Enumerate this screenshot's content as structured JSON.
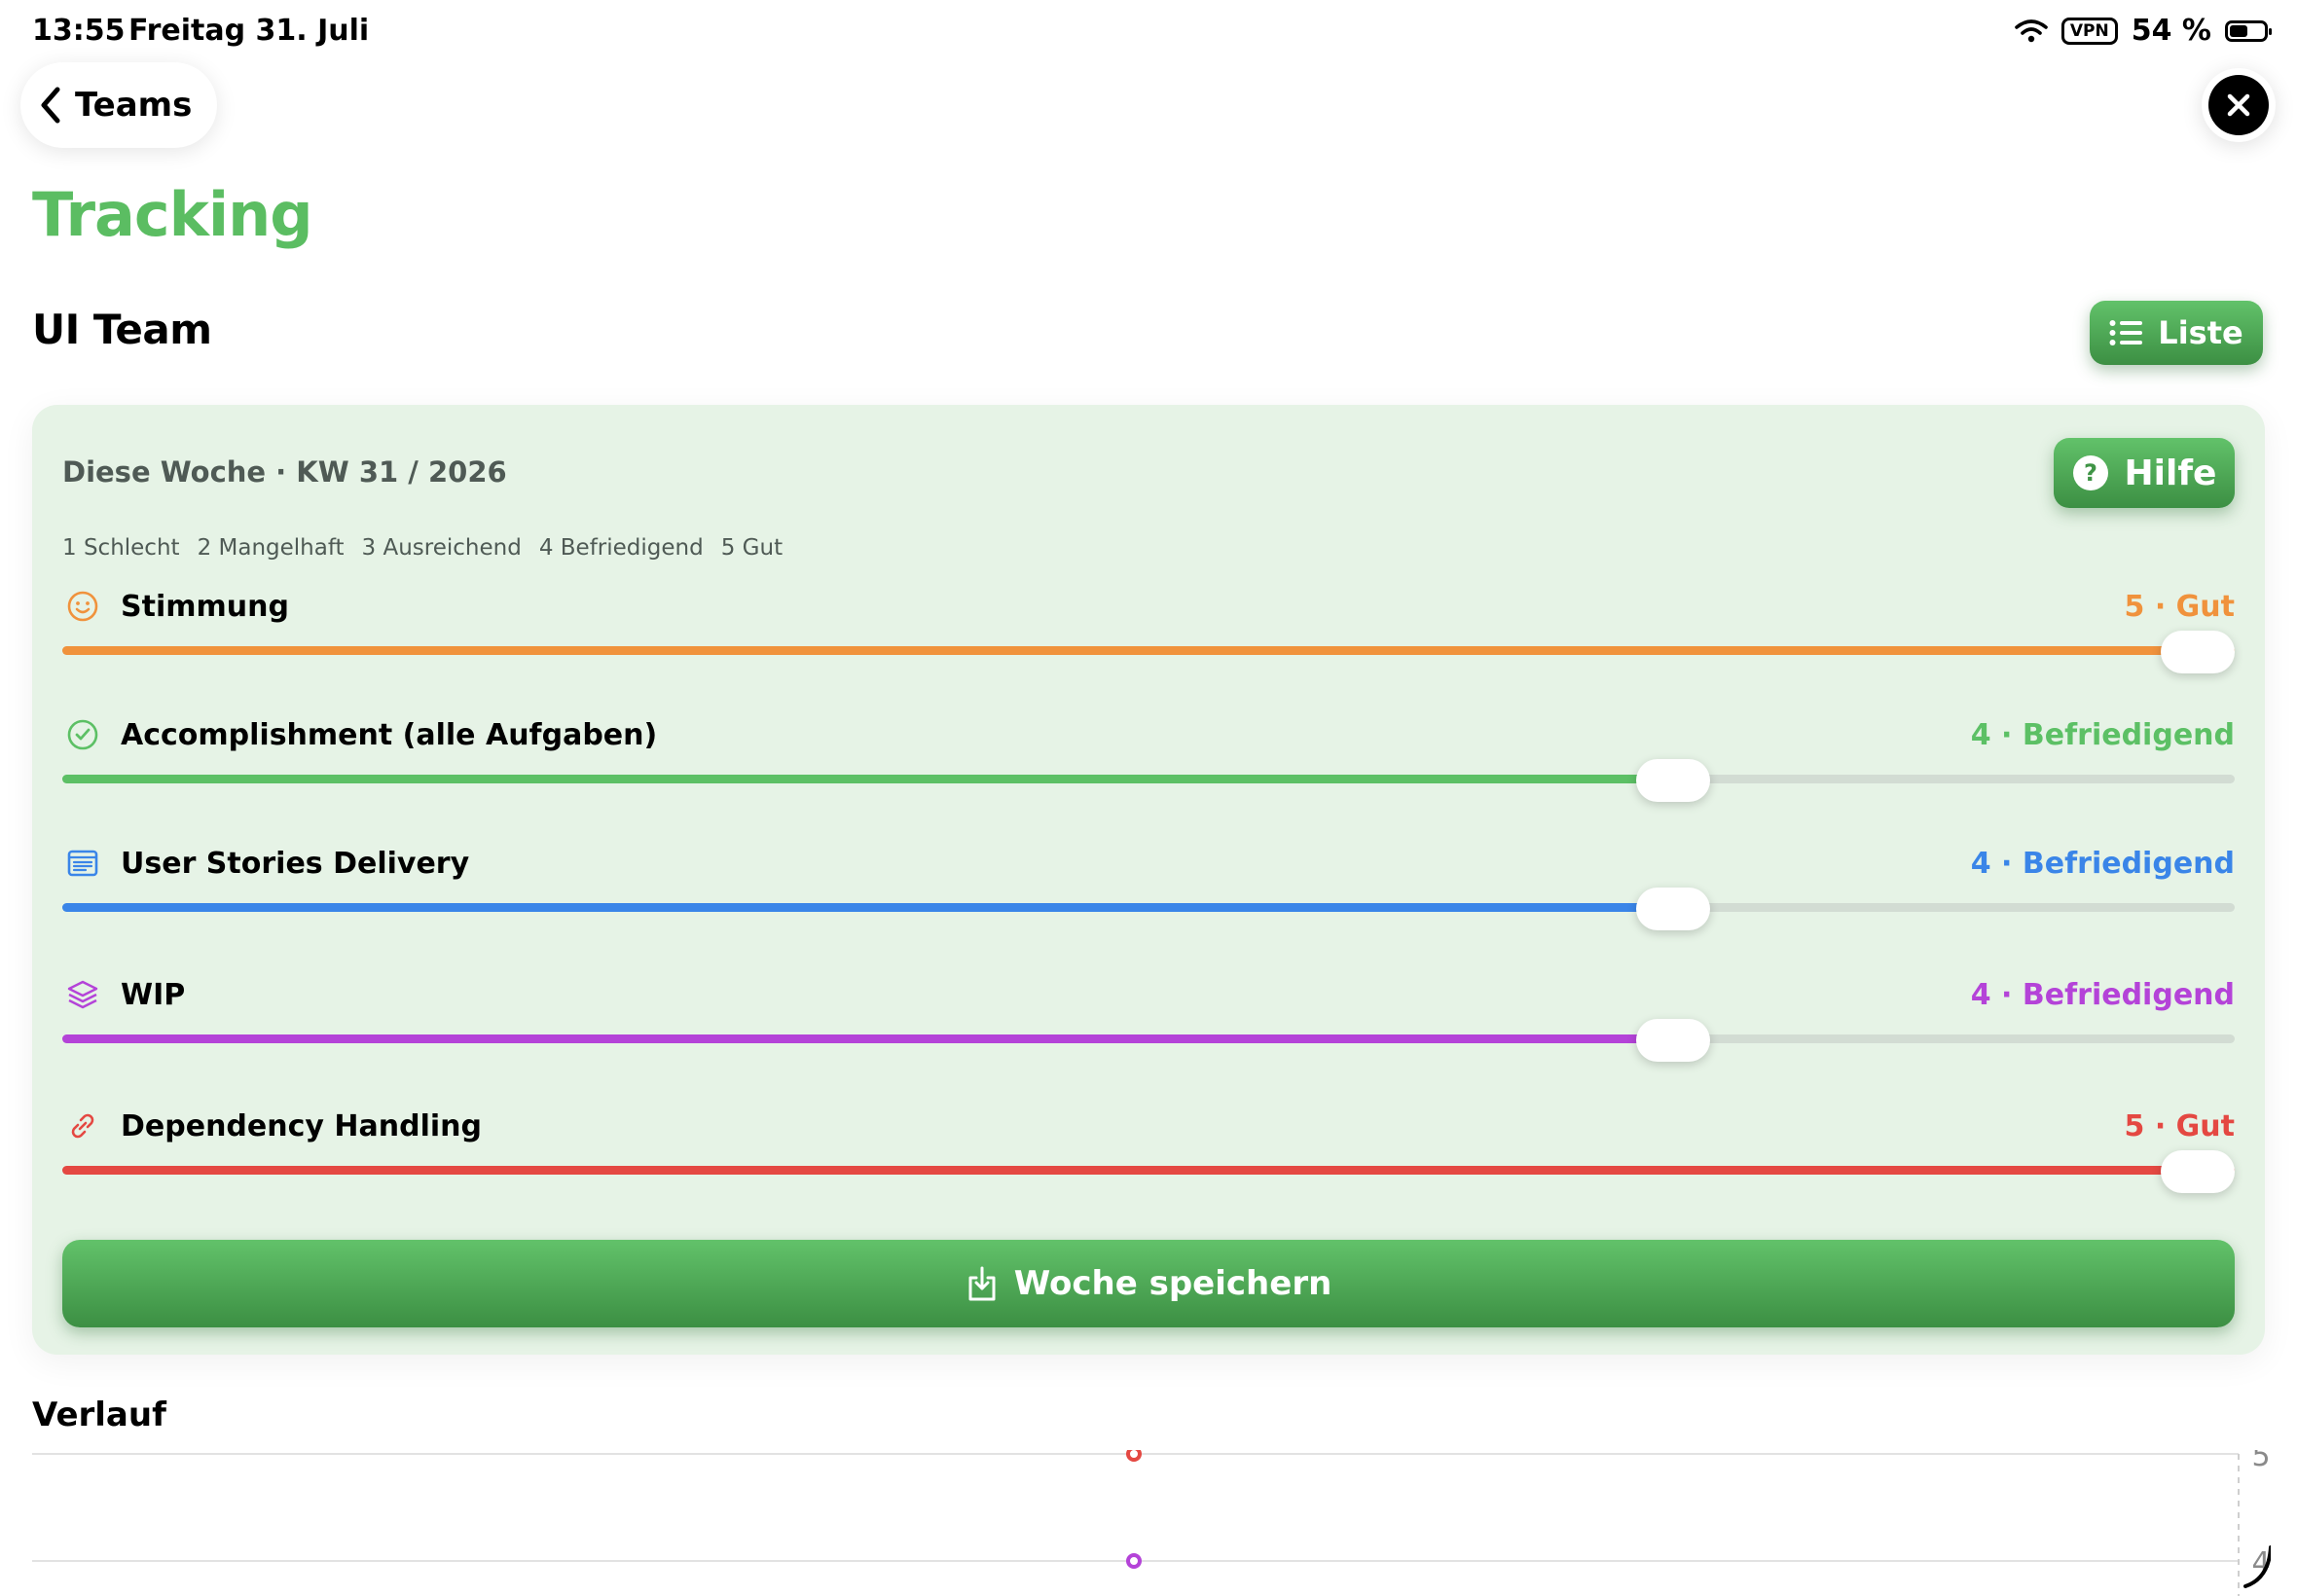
{
  "status_bar": {
    "time": "13:55",
    "date": "Freitag 31. Juli",
    "vpn": "VPN",
    "battery_text": "54 %",
    "battery_level": 0.54
  },
  "nav": {
    "back_label": "Teams"
  },
  "page": {
    "title": "Tracking",
    "team_name": "UI Team",
    "list_button": "Liste"
  },
  "week_card": {
    "week_label": "Diese Woche · KW 31 / 2026",
    "help_button": "Hilfe",
    "scale": [
      "1 Schlecht",
      "2 Mangelhaft",
      "3 Ausreichend",
      "4 Befriedigend",
      "5 Gut"
    ],
    "metrics": [
      {
        "label": "Stimmung",
        "value_text": "5 · Gut",
        "value": 5,
        "color": "#f0923c",
        "icon": "smiley-icon"
      },
      {
        "label": "Accomplishment (alle Aufgaben)",
        "value_text": "4 · Befriedigend",
        "value": 4,
        "color": "#5cc065",
        "icon": "checkmark-circle-icon"
      },
      {
        "label": "User Stories Delivery",
        "value_text": "4 · Befriedigend",
        "value": 4,
        "color": "#3a85e8",
        "icon": "list-card-icon"
      },
      {
        "label": "WIP",
        "value_text": "4 · Befriedigend",
        "value": 4,
        "color": "#b443d8",
        "icon": "layers-icon"
      },
      {
        "label": "Dependency Handling",
        "value_text": "5 · Gut",
        "value": 5,
        "color": "#e44842",
        "icon": "link-icon"
      }
    ],
    "save_button": "Woche speichern",
    "slider_min": 1,
    "slider_max": 5
  },
  "history": {
    "title": "Verlauf",
    "chart_data": {
      "type": "line",
      "y_ticks": [
        "5",
        "4"
      ],
      "series": [
        {
          "color": "#e44842",
          "values": [
            5
          ]
        },
        {
          "color": "#b443d8",
          "values": [
            4
          ]
        }
      ]
    }
  },
  "colors": {
    "accent": "#5bbd62",
    "card_bg": "#e6f3e6"
  }
}
